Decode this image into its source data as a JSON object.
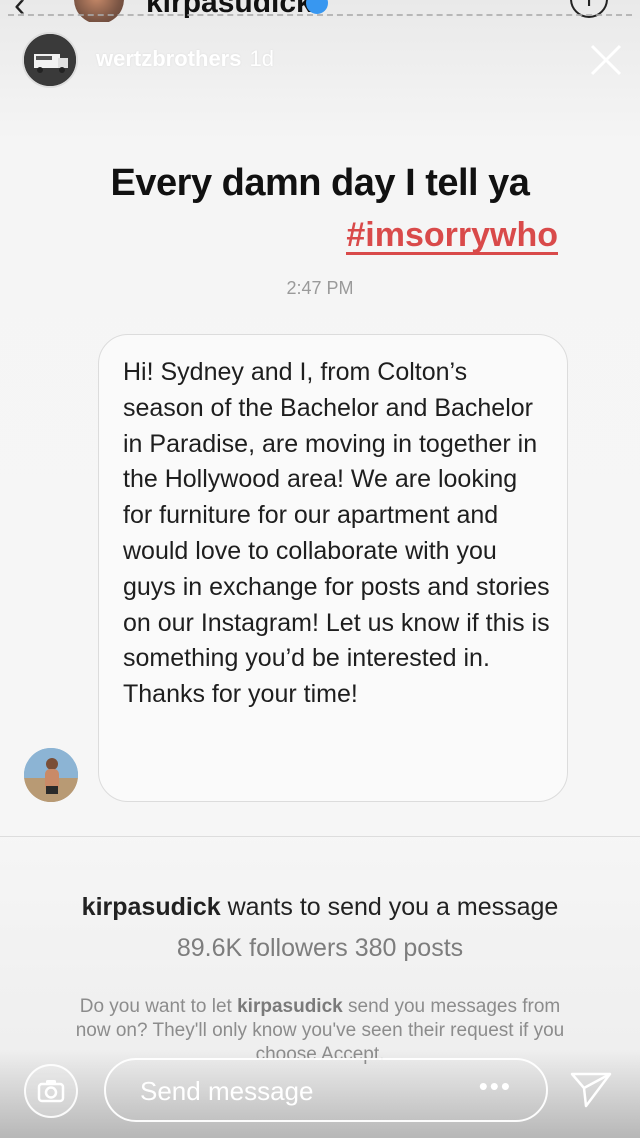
{
  "top_header": {
    "username": "kirpasudick"
  },
  "story": {
    "username": "wertzbrothers",
    "time": "1d",
    "caption": "Every damn day I tell ya",
    "hashtag": "#imsorrywho"
  },
  "thread": {
    "timestamp": "2:47 PM",
    "message": "Hi! Sydney and I, from Colton’s season of the Bachelor and Bachelor in Paradise, are moving in together in the Hollywood area! We are looking for furniture for our apartment and would love to collaborate with you guys in exchange for posts and stories on our Instagram! Let us know if this is something you’d be interested in. Thanks for your time!"
  },
  "request": {
    "username": "kirpasudick",
    "title_suffix": " wants to send you a message",
    "stats": "89.6K followers 380 posts",
    "note_prefix": "Do you want to let ",
    "note_username": "kirpasudick",
    "note_suffix": " send you messages from now on? They'll only know you've seen their request if you choose Accept."
  },
  "reply_bar": {
    "placeholder": "Send message",
    "more": "•••"
  },
  "colors": {
    "hashtag": "#d94a4a",
    "verified": "#3897f0"
  },
  "icons": [
    "back-chevron-icon",
    "verified-badge-icon",
    "info-icon",
    "close-icon",
    "camera-icon",
    "more-icon",
    "send-icon"
  ]
}
